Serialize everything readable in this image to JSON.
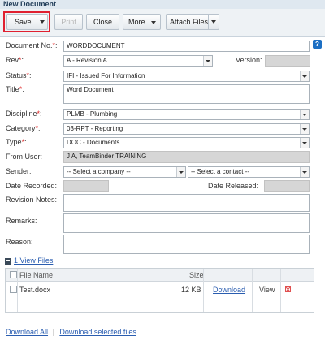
{
  "window": {
    "title": "New Document"
  },
  "toolbar": {
    "save_label": "Save",
    "print_label": "Print",
    "close_label": "Close",
    "more_label": "More",
    "attach_label": "Attach Files"
  },
  "form": {
    "document_no": {
      "label": "Document No.",
      "required": "*",
      "suffix": ":",
      "value": "WORDDOCUMENT"
    },
    "rev": {
      "label": "Rev",
      "required": "*",
      "suffix": ":",
      "value": "A - Revision A"
    },
    "version": {
      "label": "Version:",
      "value": ""
    },
    "status": {
      "label": "Status",
      "required": "*",
      "suffix": ":",
      "value": "IFI - Issued For Information"
    },
    "title": {
      "label": "Title",
      "required": "*",
      "suffix": ":",
      "value": "Word Document"
    },
    "discipline": {
      "label": "Discipline",
      "required": "*",
      "suffix": ":",
      "value": "PLMB - Plumbing"
    },
    "category": {
      "label": "Category",
      "required": "*",
      "suffix": ":",
      "value": "03-RPT - Reporting"
    },
    "type": {
      "label": "Type",
      "required": "*",
      "suffix": ":",
      "value": "DOC - Documents"
    },
    "from_user": {
      "label": "From User:",
      "value": "J A, TeamBinder TRAINING"
    },
    "sender": {
      "label": "Sender:",
      "company_placeholder": "-- Select a company --",
      "contact_placeholder": "-- Select a contact --"
    },
    "date_recorded": {
      "label": "Date Recorded:",
      "value": ""
    },
    "date_released": {
      "label": "Date Released:",
      "value": ""
    },
    "revision_notes": {
      "label": "Revision Notes:",
      "value": ""
    },
    "remarks": {
      "label": "Remarks:",
      "value": ""
    },
    "reason": {
      "label": "Reason:",
      "value": ""
    }
  },
  "files": {
    "toggle_link": "1 View Files",
    "columns": {
      "name": "File Name",
      "size": "Size"
    },
    "rows": [
      {
        "name": "Test.docx",
        "size": "12 KB",
        "download": "Download",
        "view": "View"
      }
    ]
  },
  "footer": {
    "download_all": "Download All",
    "separator": "|",
    "download_selected": "Download selected files"
  },
  "colors": {
    "accent_red": "#e02030",
    "link_blue": "#2a5db0",
    "help_blue": "#1c6fc4"
  }
}
